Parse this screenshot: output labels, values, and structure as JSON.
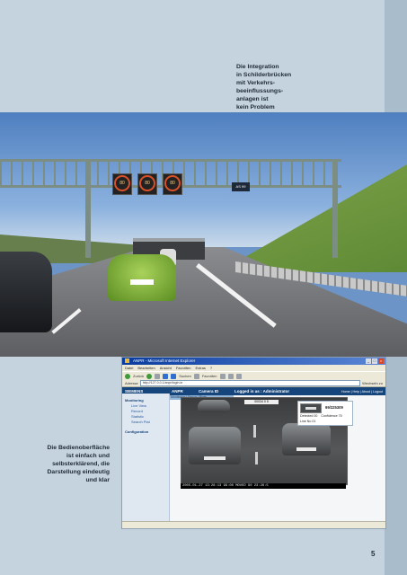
{
  "captions": {
    "top": [
      "Die Integration",
      "in Schilderbrücken",
      "mit Verkehrs-",
      "beeinflussungs-",
      "anlagen ist",
      "kein Problem"
    ],
    "left": [
      "Die Bedienoberfläche",
      "ist einfach und",
      "selbsterklärend, die",
      "Darstellung eindeutig",
      "und klar"
    ]
  },
  "page_number": "5",
  "photo": {
    "speed_signs": [
      "80",
      "80",
      "80"
    ],
    "distance_sign": "AS 99",
    "green_car_plate": "",
    "colors": {
      "sky": "#6d94c6",
      "road": "#6a6c6f",
      "hill": "#7ea34a"
    }
  },
  "software": {
    "window_title": "ANPR - Microsoft Internet Explorer",
    "menu": [
      "Datei",
      "Bearbeiten",
      "Ansicht",
      "Favoriten",
      "Extras",
      "?"
    ],
    "toolbar": [
      "Zurück",
      "Suchen",
      "Favoriten"
    ],
    "address_label": "Adresse",
    "address_value": "http://127.0.0.1/anpr/login.ie",
    "links_label": "Wechseln zu",
    "brand": "SIEMENS",
    "app_name": "ANPR",
    "camera_label": "Camera ID",
    "login_text": "Logged in as : Administrator",
    "header_links": "Home | Help | About | Logout",
    "sub_tab": "Monitoring | Fence | Plate",
    "sidebar": {
      "section1": "Monitoring",
      "items1": [
        "Live View",
        "Record",
        "Statistic",
        "Search Plat"
      ],
      "section2": "Configuration"
    },
    "plate_number": "99/225309",
    "panel_rows": [
      {
        "label": "Detected",
        "value": "00"
      },
      {
        "label": "Confidence",
        "value": "75"
      },
      {
        "label": "Line No",
        "value": "01"
      }
    ],
    "video_tag": "00034   0   5",
    "video_caption": "2005-01-27  13:28:13  99:00  MOVED  90 23:26:5",
    "colors": {
      "app_header": "#15457a",
      "titlebar": "#0a3c9e",
      "sidebar": "#dfe7f1"
    }
  }
}
